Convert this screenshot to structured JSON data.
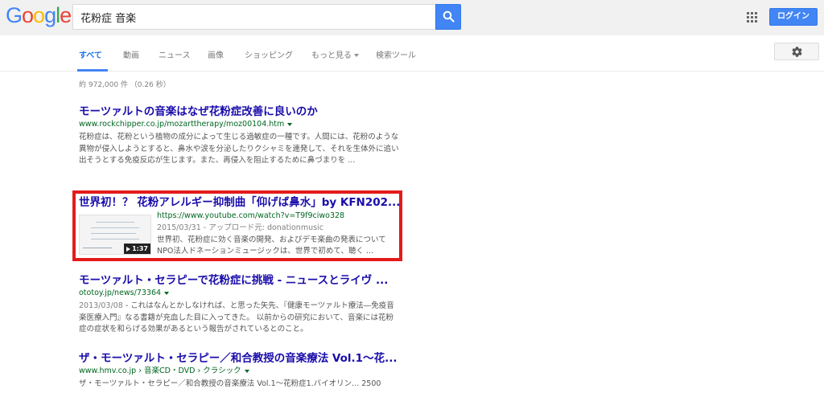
{
  "header": {
    "logo_letters": [
      "G",
      "o",
      "o",
      "g",
      "l",
      "e"
    ],
    "search_value": "花粉症 音楽",
    "login_label": "ログイン"
  },
  "colors": {
    "logo": [
      "#4285f4",
      "#ea4335",
      "#fbbc05",
      "#4285f4",
      "#34a853",
      "#ea4335"
    ],
    "accent": "#4285f4",
    "title_link": "#1a0dab",
    "url_green": "#006621",
    "highlight_border": "#e41b1b"
  },
  "tabs": [
    {
      "label": "すべて",
      "active": true
    },
    {
      "label": "動画"
    },
    {
      "label": "ニュース"
    },
    {
      "label": "画像"
    },
    {
      "label": "ショッピング"
    },
    {
      "label": "もっと見る"
    },
    {
      "label": "検索ツール"
    }
  ],
  "stats": "約 972,000 件 （0.26 秒）",
  "results": [
    {
      "title": "モーツァルトの音楽はなぜ花粉症改善に良いのか",
      "url": "www.rockchipper.co.jp/mozarttherapy/moz00104.htm",
      "snippet": "花粉症は、花粉という植物の成分によって生じる過敏症の一種です。人間には、花粉のような異物が侵入しようとすると、鼻水や涙を分泌したりクシャミを連発して、それを生体外に追い出そうとする免疫反応が生じます。また、再侵入を阻止するために鼻づまりを ..."
    },
    {
      "title": "世界初！？ 花粉アレルギー抑制曲「仰げば鼻水」by KFN202...",
      "url": "https://www.youtube.com/watch?v=T9f9ciwo328",
      "meta": "2015/03/31 - アップロード元: donationmusic",
      "snippet": "世界初、花粉症に効く音楽の開発、およびデモ楽曲の発表について NPO法人ドネーションミュージックは、世界で初めて、聴く ...",
      "duration": "1:37"
    },
    {
      "title": "モーツァルト・セラピーで花粉症に挑戦 - ニュースとライヴ ...",
      "url": "ototoy.jp/news/73364",
      "date": "2013/03/08",
      "snippet": "これはなんとかしなければ、と思った矢先、『健康モーツァルト療法―免疫音楽医療入門』なる書籍が充血した目に入ってきた。 以前からの研究において、音楽には花粉症の症状を和らげる効果があるという報告がされているとのこと。"
    },
    {
      "title": "ザ・モーツァルト・セラピー／和合教授の音楽療法 Vol.1〜花...",
      "url": "www.hmv.co.jp › 音楽CD・DVD › クラシック",
      "snippet": "ザ・モーツァルト・セラピー／和合教授の音楽療法 Vol.1〜花粉症1.バイオリン... 2500"
    }
  ]
}
